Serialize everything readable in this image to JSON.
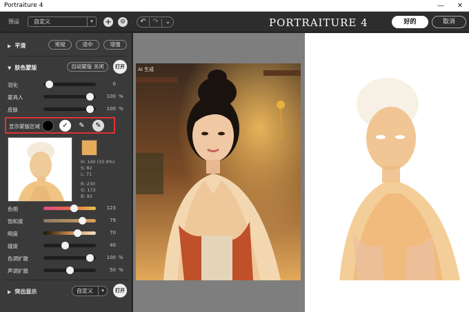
{
  "window": {
    "title": "Portraiture 4",
    "minimize": "—",
    "close": "✕"
  },
  "toolbar": {
    "preset_label": "预设",
    "preset_value": "自定义",
    "add_icon": "+",
    "settings_icon": "⚙",
    "undo_icon": "↶",
    "redo_icon": "↷",
    "history_icon": "⌄",
    "brand": "PORTRAITURE 4",
    "ok_label": "好的",
    "cancel_label": "取消"
  },
  "smoothing": {
    "title": "平滑",
    "buttons": [
      "常规",
      "适中",
      "增强"
    ]
  },
  "skin_mask": {
    "title": "肤色蒙版",
    "auto_mask_label": "自动蒙版 关闭",
    "toggle_label": "打开",
    "sliders": [
      {
        "label": "羽化",
        "value": 0,
        "unit": "",
        "fraction": 0.04
      },
      {
        "label": "蒙具人",
        "value": 100,
        "unit": "%",
        "fraction": 0.96
      },
      {
        "label": "皮肤",
        "value": 100,
        "unit": "%",
        "fraction": 0.96
      }
    ],
    "show_mask_label": "显示蒙版区域",
    "color_info": {
      "h": "H: 140 (33.9%)",
      "s": "S: 82",
      "l": "L: 71",
      "r": "R: 230",
      "g": "G: 172",
      "b": "B: 92"
    },
    "chip_color": "#e6ac5c",
    "adjust_sliders": [
      {
        "label": "色相",
        "value": 123,
        "unit": "",
        "fraction": 0.6,
        "track": "hue"
      },
      {
        "label": "饱和度",
        "value": 79,
        "unit": "",
        "fraction": 0.78,
        "track": "sat"
      },
      {
        "label": "明度",
        "value": 70,
        "unit": "",
        "fraction": 0.68,
        "track": "lum"
      },
      {
        "label": "缝度",
        "value": 40,
        "unit": "",
        "fraction": 0.4,
        "track": "plain"
      },
      {
        "label": "色调扩散",
        "value": 100,
        "unit": "%",
        "fraction": 0.96,
        "track": "plain"
      },
      {
        "label": "声调扩散",
        "value": 50,
        "unit": "%",
        "fraction": 0.5,
        "track": "plain"
      }
    ]
  },
  "highlight": {
    "title": "突出显示",
    "preset_value": "自定义",
    "toggle_label": "打开"
  },
  "canvas": {
    "ai_badge": "AI 生成"
  },
  "colors": {
    "accent_red": "#e03131",
    "panel_bg": "#3a3a3a",
    "canvas_bg": "#7e7e7e"
  }
}
